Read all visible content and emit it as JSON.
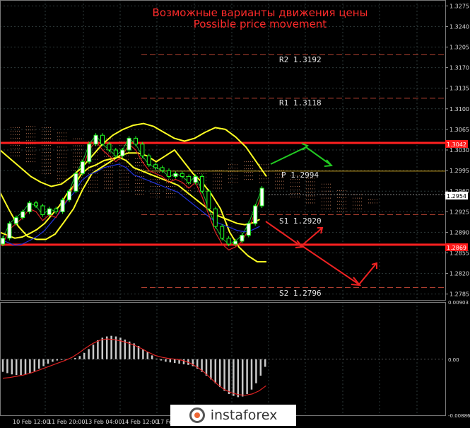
{
  "header": {
    "title_ru": "Возможные варианты движения цены",
    "title_en": "Possible price movement",
    "title_color": "#ff2a2a"
  },
  "levels": {
    "r2": "R2 1.3192",
    "r1": "R1 1.3118",
    "p": "P 1.2994",
    "s1": "S1 1.2920",
    "s2": "S2 1.2796",
    "resistance_tag": "1.3042",
    "support_tag": "1.2869",
    "current_price_tag": "1.2954"
  },
  "watermark": "instaforex",
  "colors": {
    "background": "#000000",
    "grid": "#2e3a3a",
    "bollinger": "#ffff22",
    "horizontal_levels": "#ff2020",
    "pivot_lines": "#b04030",
    "arrow_up": "#22cc22",
    "arrow_down": "#ee2222",
    "candles": "#22ff22",
    "macd_hist": "#c8c8c8",
    "macd_signal": "#dd2222"
  },
  "chart_data": [
    {
      "type": "line",
      "instrument_note": "price chart",
      "x_tick_labels": [
        "10 Feb 12:00",
        "11 Feb 20:00",
        "13 Feb 04:00",
        "14 Feb 12:00",
        "17 Feb"
      ],
      "y_tick_labels": [
        "1.3275",
        "1.3240",
        "1.3205",
        "1.3170",
        "1.3135",
        "1.3100",
        "1.3065",
        "1.3030",
        "1.2995",
        "1.2960",
        "1.2925",
        "1.2890",
        "1.2855",
        "1.2820",
        "1.2785"
      ],
      "ylim": [
        1.2775,
        1.3285
      ],
      "horizontal_lines": [
        {
          "label": "R2",
          "value": 1.3192
        },
        {
          "label": "R1",
          "value": 1.3118
        },
        {
          "label": "P",
          "value": 1.2994
        },
        {
          "label": "S1",
          "value": 1.292
        },
        {
          "label": "S2",
          "value": 1.2796
        },
        {
          "label": "resistance",
          "value": 1.3042
        },
        {
          "label": "support",
          "value": 1.2869
        }
      ],
      "last_price": 1.2954,
      "series": [
        {
          "values": [
            1.288,
            1.2905,
            1.2915,
            1.2925,
            1.294,
            1.2935,
            1.292,
            1.293,
            1.2925,
            1.2945,
            1.296,
            1.299,
            1.301,
            1.304,
            1.3055,
            1.304,
            1.303,
            1.302,
            1.303,
            1.305,
            1.304,
            1.302,
            1.3005,
            1.3,
            1.2995,
            1.2985,
            1.299,
            1.2985,
            1.2975,
            1.2985,
            1.296,
            1.293,
            1.29,
            1.288,
            1.287,
            1.2875,
            1.2885,
            1.2905,
            1.2935,
            1.2965
          ]
        },
        {
          "values": [
            1.303,
            1.3015,
            1.3,
            1.2985,
            1.2975,
            1.2968,
            1.2972,
            1.2985,
            1.3,
            1.302,
            1.304,
            1.3055,
            1.3065,
            1.3072,
            1.3075,
            1.307,
            1.306,
            1.305,
            1.3045,
            1.305,
            1.306,
            1.3068,
            1.3065,
            1.3052,
            1.3035,
            1.301,
            1.2985
          ]
        },
        {
          "values": [
            1.289,
            1.2885,
            1.288,
            1.2882,
            1.2888,
            1.2895,
            1.2905,
            1.292,
            1.2935,
            1.2955,
            1.297,
            1.299,
            1.3,
            1.3005,
            1.3012,
            1.3015,
            1.3018,
            1.3012,
            1.3,
            1.2995,
            1.299,
            1.2985,
            1.298,
            1.2975,
            1.297,
            1.296,
            1.295,
            1.294,
            1.293,
            1.292,
            1.2915,
            1.291,
            1.2905,
            1.2903,
            1.2906,
            1.2912
          ]
        },
        {
          "values": [
            1.2958,
            1.2928,
            1.29,
            1.2883,
            1.2878,
            1.2878,
            1.2887,
            1.2908,
            1.293,
            1.2963,
            1.299,
            1.3,
            1.301,
            1.302,
            1.3025,
            1.3025,
            1.302,
            1.301,
            1.302,
            1.303,
            1.301,
            1.299,
            1.2975,
            1.2955,
            1.293,
            1.289,
            1.2865,
            1.285,
            1.284,
            1.284
          ]
        }
      ]
    },
    {
      "type": "bar",
      "instrument_note": "MACD oscillator",
      "y_tick_labels": [
        "0.00903",
        "0.00",
        "-0.00886"
      ],
      "ylim": [
        -0.00886,
        0.00903
      ],
      "series": [
        {
          "values": [
            -0.002,
            -0.0022,
            -0.0024,
            -0.0025,
            -0.0025,
            -0.0024,
            -0.0022,
            -0.0019,
            -0.0015,
            -0.0011,
            -0.0007,
            -0.0004,
            -0.0002,
            -0.0001,
            -0.0001,
            0.0,
            0.0002,
            0.0005,
            0.001,
            0.0016,
            0.0023,
            0.003,
            0.0034,
            0.0036,
            0.0037,
            0.0036,
            0.0034,
            0.0031,
            0.0028,
            0.0025,
            0.0021,
            0.0016,
            0.0011,
            0.0006,
            0.0001,
            -0.0002,
            -0.0004,
            -0.0005,
            -0.0006,
            -0.0007,
            -0.0008,
            -0.0009,
            -0.0011,
            -0.0015,
            -0.002,
            -0.0026,
            -0.0032,
            -0.0038,
            -0.0044,
            -0.005,
            -0.0055,
            -0.0058,
            -0.006,
            -0.0059,
            -0.0055,
            -0.0048,
            -0.0038,
            -0.0026,
            -0.0012
          ]
        },
        {
          "values": [
            -0.003,
            -0.0029,
            -0.0027,
            -0.0025,
            -0.0022,
            -0.0018,
            -0.0014,
            -0.001,
            -0.0006,
            -0.0002,
            0.0003,
            0.001,
            0.0018,
            0.0025,
            0.003,
            0.0032,
            0.0031,
            0.0029,
            0.0026,
            0.0022,
            0.0017,
            0.0011,
            0.0006,
            0.0003,
            0.0001,
            0.0,
            -0.0002,
            -0.0006,
            -0.0012,
            -0.002,
            -0.003,
            -0.004,
            -0.0048,
            -0.0053,
            -0.0056,
            -0.0057,
            -0.0055,
            -0.005,
            -0.0042
          ]
        }
      ]
    }
  ]
}
